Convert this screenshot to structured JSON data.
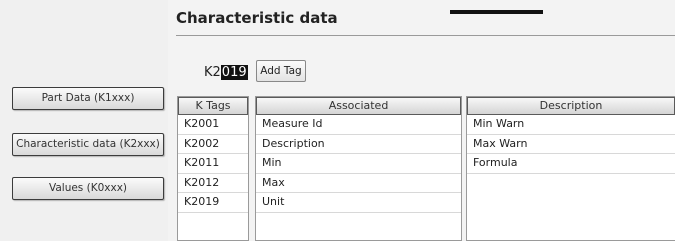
{
  "nav": {
    "buttons": [
      "Part Data (K1xxx)",
      "Characteristic data (K2xxx)",
      "Values (K0xxx)"
    ]
  },
  "main": {
    "title": "Characteristic data",
    "entry_prefix": "K2",
    "entry_selected": "019",
    "add_tag_label": "Add Tag"
  },
  "tables": {
    "ktags": {
      "header": "K Tags",
      "rows": [
        "K2001",
        "K2002",
        "K2011",
        "K2012",
        "K2019"
      ]
    },
    "associated": {
      "header": "Associated",
      "rows": [
        "Measure Id",
        "Description",
        "Min",
        "Max",
        "Unit"
      ]
    },
    "description": {
      "header": "Description",
      "rows": [
        "Min Warn",
        "Max Warn",
        "Formula"
      ]
    }
  }
}
